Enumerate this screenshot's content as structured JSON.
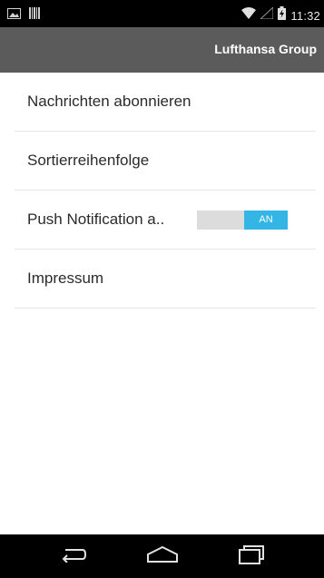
{
  "status_bar": {
    "time": "11:32",
    "icons": [
      "screenshot-icon",
      "barcode-icon",
      "wifi-icon",
      "signal-icon",
      "battery-charging-icon"
    ]
  },
  "action_bar": {
    "brand": "Lufthansa Group"
  },
  "settings": {
    "items": [
      {
        "label": "Nachrichten abonnieren"
      },
      {
        "label": "Sortierreihenfolge"
      },
      {
        "label": "Push Notification a..",
        "toggle": {
          "state_label": "AN",
          "on": true
        }
      },
      {
        "label": "Impressum"
      }
    ]
  },
  "nav_bar": {
    "buttons": [
      "back-icon",
      "home-icon",
      "recent-apps-icon"
    ]
  },
  "colors": {
    "accent": "#33b5e5",
    "action_bar": "#5b5b5b"
  }
}
